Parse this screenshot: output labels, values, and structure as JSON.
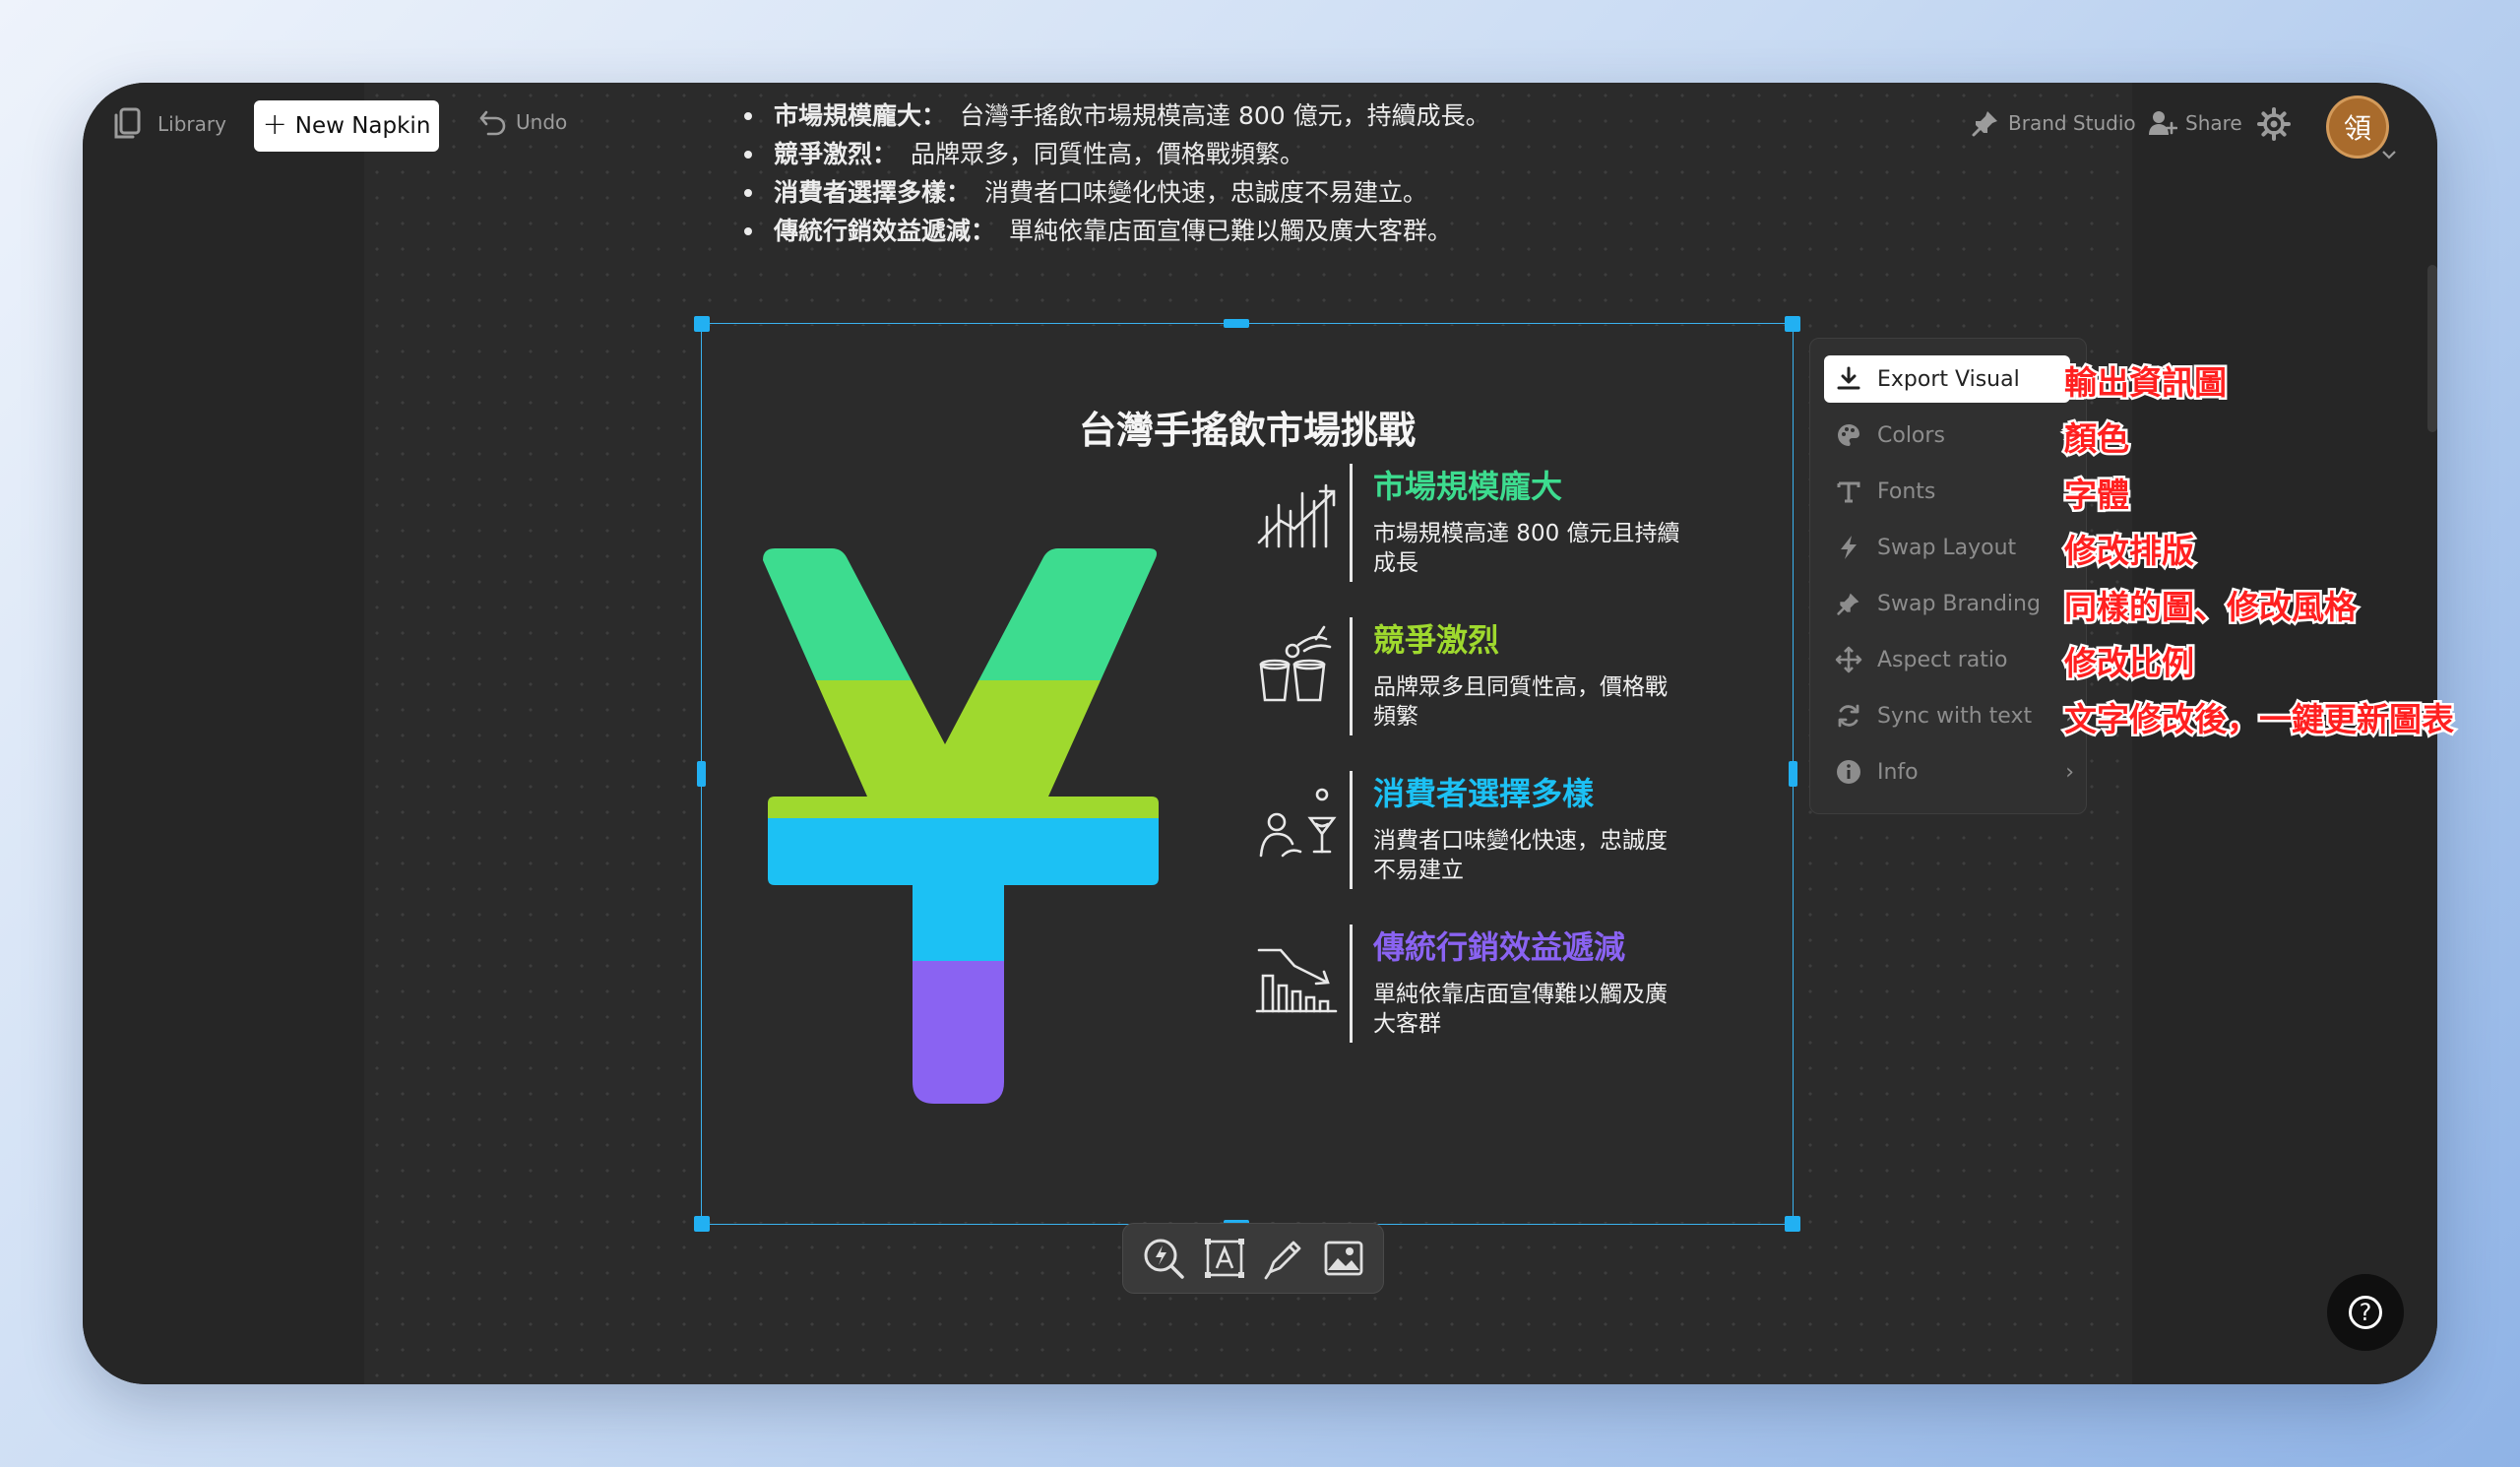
{
  "topbar": {
    "library_label": "Library",
    "new_napkin_label": "New Napkin",
    "undo_label": "Undo",
    "brand_studio_label": "Brand Studio",
    "share_label": "Share",
    "avatar_initial": "領"
  },
  "source_text": [
    {
      "key": "市場規模龐大：",
      "text": "台灣手搖飲市場規模高達 800 億元，持續成長。"
    },
    {
      "key": "競爭激烈：",
      "text": "品牌眾多，同質性高，價格戰頻繁。"
    },
    {
      "key": "消費者選擇多樣：",
      "text": "消費者口味變化快速，忠誠度不易建立。"
    },
    {
      "key": "傳統行銷效益遞減：",
      "text": "單純依靠店面宣傳已難以觸及廣大客群。"
    }
  ],
  "visual": {
    "title": "台灣手搖飲市場挑戰",
    "items": [
      {
        "heading": "市場規模龐大",
        "desc": "市場規模高達 800 億元且持續成長",
        "color": "#3ddc8f",
        "icon": "growth-chart-icon"
      },
      {
        "heading": "競爭激烈",
        "desc": "品牌眾多且同質性高，價格戰頻繁",
        "color": "#9fd92e",
        "icon": "drink-cups-icon"
      },
      {
        "heading": "消費者選擇多樣",
        "desc": "消費者口味變化快速，忠誠度不易建立",
        "color": "#1cc1f4",
        "icon": "person-choice-icon"
      },
      {
        "heading": "傳統行銷效益遞減",
        "desc": "單純依靠店面宣傳難以觸及廣大客群",
        "color": "#8a63f2",
        "icon": "declining-chart-icon"
      }
    ]
  },
  "menu": {
    "items": [
      {
        "label": "Export Visual",
        "icon": "download-icon"
      },
      {
        "label": "Colors",
        "icon": "palette-icon"
      },
      {
        "label": "Fonts",
        "icon": "font-icon"
      },
      {
        "label": "Swap Layout",
        "icon": "bolt-icon"
      },
      {
        "label": "Swap Branding",
        "icon": "pin-icon"
      },
      {
        "label": "Aspect ratio",
        "icon": "move-icon"
      },
      {
        "label": "Sync with text",
        "icon": "sync-icon"
      },
      {
        "label": "Info",
        "icon": "info-icon"
      }
    ]
  },
  "annotations": [
    "輸出資訊圖",
    "顏色",
    "字體",
    "修改排版",
    "同樣的圖、修改風格",
    "修改比例",
    "文字修改後，一鍵更新圖表"
  ],
  "help_label": "?",
  "colors": {
    "accent": "#22b0f2",
    "green": "#3ddc8f",
    "lime": "#9fd92e",
    "cyan": "#1cc1f4",
    "purple": "#8a63f2",
    "annotation": "#ff2020"
  }
}
